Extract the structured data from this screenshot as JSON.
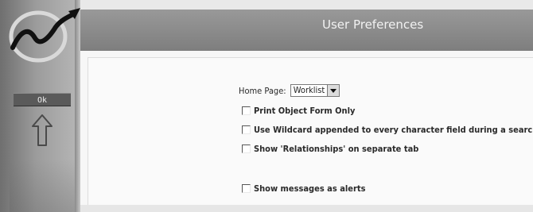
{
  "window": {
    "title": "User Preferences"
  },
  "sidebar": {
    "ok_label": "Ok",
    "logo_icon": "check-swoosh-logo",
    "arrow_icon": "up-arrow-icon"
  },
  "preferences": {
    "home_page_label": "Home Page:",
    "home_page_value": "Worklist",
    "options": [
      {
        "label": "Print Object Form Only",
        "checked": false
      },
      {
        "label": "Use Wildcard appended to every character field during a search",
        "checked": false
      },
      {
        "label": "Show 'Relationships' on separate tab",
        "checked": false
      },
      {
        "label": "Show messages as alerts",
        "checked": false
      }
    ]
  },
  "colors": {
    "sidebar": "#9c9c9c",
    "titlebar": "#8d8d8d",
    "ok_button": "#5a5a5a",
    "content": "#f7f7f7"
  }
}
